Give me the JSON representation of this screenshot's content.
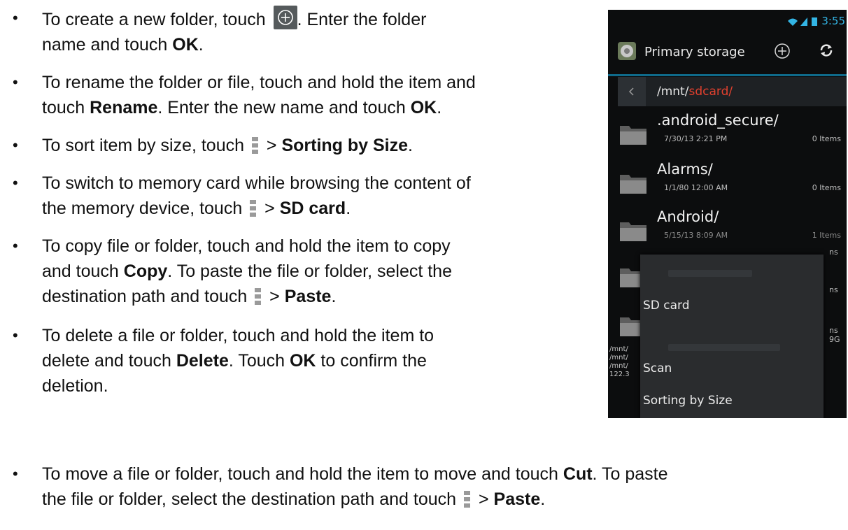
{
  "bullets": [
    {
      "segments": [
        {
          "t": "To create a new folder, touch "
        },
        {
          "icon": "plus-icon"
        },
        {
          "t": ". Enter the folder"
        },
        {
          "br": true
        },
        {
          "t": "name and touch "
        },
        {
          "b": "OK"
        },
        {
          "t": "."
        }
      ]
    },
    {
      "segments": [
        {
          "t": "To rename the folder or file, touch and hold the item and"
        },
        {
          "br": true
        },
        {
          "t": "touch "
        },
        {
          "b": "Rename"
        },
        {
          "t": ". Enter the new name and touch "
        },
        {
          "b": "OK"
        },
        {
          "t": "."
        }
      ]
    },
    {
      "segments": [
        {
          "t": "To sort item by size, touch "
        },
        {
          "icon": "menu-icon"
        },
        {
          "t": " > "
        },
        {
          "b": "Sorting by Size"
        },
        {
          "t": "."
        }
      ]
    },
    {
      "segments": [
        {
          "t": "To switch to memory card while browsing the content of"
        },
        {
          "br": true
        },
        {
          "t": "the memory device, touch "
        },
        {
          "icon": "menu-icon"
        },
        {
          "t": " > "
        },
        {
          "b": "SD card"
        },
        {
          "t": "."
        }
      ]
    },
    {
      "segments": [
        {
          "t": "To copy file or folder, touch and hold the item to copy"
        },
        {
          "br": true
        },
        {
          "t": "and touch "
        },
        {
          "b": "Copy"
        },
        {
          "t": ". To paste the file or folder, select the"
        },
        {
          "br": true
        },
        {
          "t": "destination path and touch "
        },
        {
          "icon": "menu-icon"
        },
        {
          "t": " > "
        },
        {
          "b": "Paste"
        },
        {
          "t": "."
        }
      ]
    },
    {
      "segments": [
        {
          "t": "To delete a file or folder, touch and hold the item to"
        },
        {
          "br": true
        },
        {
          "t": "delete and touch "
        },
        {
          "b": "Delete"
        },
        {
          "t": ". Touch "
        },
        {
          "b": "OK"
        },
        {
          "t": " to confirm the"
        },
        {
          "br": true
        },
        {
          "t": "deletion."
        }
      ]
    },
    {
      "segments": [
        {
          "t": "To move a file or folder, touch and hold the item to move and touch "
        },
        {
          "b": "Cut"
        },
        {
          "t": ". To paste"
        },
        {
          "br": true
        },
        {
          "t": "the file or folder, select the destination path and touch "
        },
        {
          "icon": "menu-icon"
        },
        {
          "t": " > "
        },
        {
          "b": "Paste"
        },
        {
          "t": "."
        }
      ]
    }
  ],
  "bullet_char": "•",
  "phone": {
    "status_time": "3:55",
    "title": "Primary storage",
    "path_prefix": "/mnt/",
    "path_highlight": "sdcard/",
    "files": [
      {
        "name": ".android_secure/",
        "date": "7/30/13 2:21 PM",
        "count": "0 Items"
      },
      {
        "name": "Alarms/",
        "date": "1/1/80 12:00 AM",
        "count": "0 Items"
      },
      {
        "name": "Android/",
        "date": "5/15/13 8:09 AM",
        "count": "1 Items"
      }
    ],
    "covered_right": [
      "ns",
      "ns",
      "ns",
      "9G"
    ],
    "covered_left": [
      "/mnt/",
      "/mnt/",
      "/mnt/",
      "122.3"
    ],
    "menu": {
      "sd_card": "SD card",
      "scan": "Scan",
      "sorting": "Sorting by Size"
    },
    "accent_color": "#33b5e5",
    "path_highlight_color": "#e0402e"
  }
}
